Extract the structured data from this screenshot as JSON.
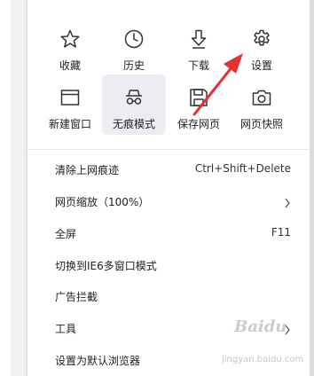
{
  "grid": [
    {
      "label": "收藏",
      "icon": "star-icon"
    },
    {
      "label": "历史",
      "icon": "clock-icon"
    },
    {
      "label": "下载",
      "icon": "download-icon"
    },
    {
      "label": "设置",
      "icon": "gear-icon"
    },
    {
      "label": "新建窗口",
      "icon": "window-icon"
    },
    {
      "label": "无痕模式",
      "icon": "incognito-icon",
      "active": true
    },
    {
      "label": "保存网页",
      "icon": "save-icon"
    },
    {
      "label": "网页快照",
      "icon": "camera-icon"
    }
  ],
  "menu_items": [
    {
      "label": "清除上网痕迹",
      "shortcut": "Ctrl+Shift+Delete",
      "submenu": false
    },
    {
      "label": "网页缩放（100%）",
      "shortcut": "",
      "submenu": true
    },
    {
      "label": "全屏",
      "shortcut": "F11",
      "submenu": false
    },
    {
      "label": "切换到IE6多窗口模式",
      "shortcut": "",
      "submenu": false
    },
    {
      "label": "广告拦截",
      "shortcut": "",
      "submenu": false
    },
    {
      "label": "工具",
      "shortcut": "",
      "submenu": true
    },
    {
      "label": "设置为默认浏览器",
      "shortcut": "",
      "submenu": false
    }
  ],
  "annotation": {
    "color": "#e8312f"
  },
  "watermark": {
    "brand": "Baidu",
    "sub": "jingyan.baidu.com"
  }
}
